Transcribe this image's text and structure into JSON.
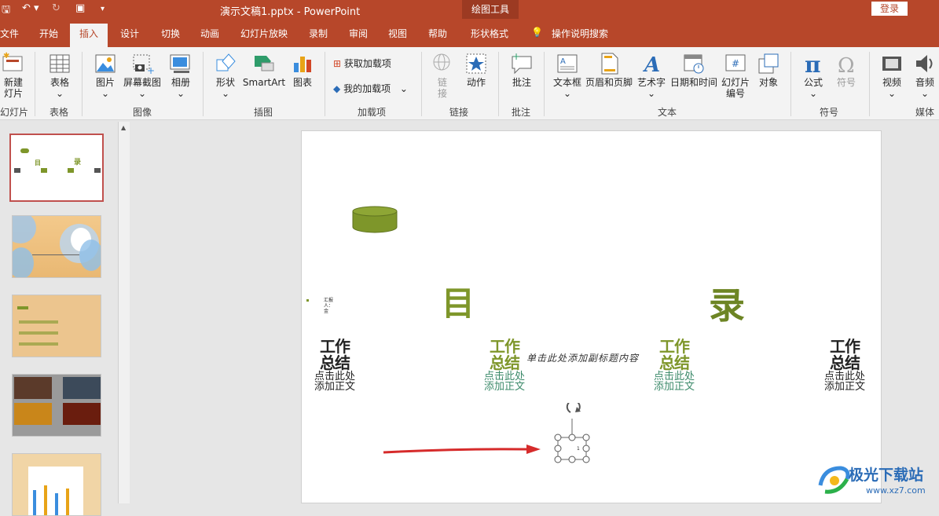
{
  "titlebar": {
    "doc_title": "演示文稿1.pptx  -  PowerPoint",
    "context_tab": "绘图工具",
    "login": "登录",
    "qa_save": "🖫",
    "qa_undo": "↶ ▾",
    "qa_redo": "↻",
    "qa_present": "▣",
    "qa_more": "▾"
  },
  "tabs": [
    "文件",
    "开始",
    "插入",
    "设计",
    "切换",
    "动画",
    "幻灯片放映",
    "录制",
    "审阅",
    "视图",
    "帮助",
    "形状格式",
    "操作说明搜索"
  ],
  "ribbon": {
    "new_slide": "新建\n灯片",
    "new_slide_group": "幻灯片",
    "table": "表格",
    "table_group": "表格",
    "picture": "图片",
    "screenshot": "屏幕截图",
    "album": "相册",
    "image_group": "图像",
    "shape": "形状",
    "smartart": "SmartArt",
    "chart": "图表",
    "illus_group": "插图",
    "get_addins": "获取加载项",
    "my_addins": "我的加载项",
    "addins_group": "加载项",
    "link": "链\n接",
    "action": "动作",
    "link_group": "链接",
    "comment": "批注",
    "comment_group": "批注",
    "textbox": "文本框",
    "header_footer": "页眉和页脚",
    "wordart": "艺术字",
    "datetime": "日期和时间",
    "slide_number": "幻灯片\n编号",
    "object": "对象",
    "text_group": "文本",
    "equation": "公式",
    "symbol": "符号",
    "symbol_group": "符号",
    "video": "视频",
    "audio": "音频",
    "media_group": "媒体"
  },
  "slide": {
    "title_left": "目",
    "title_right": "录",
    "small_text": "汇报\n人：\n金",
    "subtitle": "单击此处添加副标题内容",
    "columns": [
      {
        "big": "工作\n总结",
        "small": "点击此处\n添加正文"
      },
      {
        "big": "工作\n总结",
        "small": "点击此处\n添加正文"
      },
      {
        "big": "工作\n总结",
        "small": "点击此处\n添加正文"
      },
      {
        "big": "工作\n总结",
        "small": "点击此处\n添加正文"
      }
    ],
    "selected_text": "1"
  },
  "watermark": {
    "name": "极光下载站",
    "url": "www.xz7.com"
  },
  "colors": {
    "brand": "#b7472a",
    "olive": "#7e962a",
    "arrow": "#d62b2b"
  }
}
